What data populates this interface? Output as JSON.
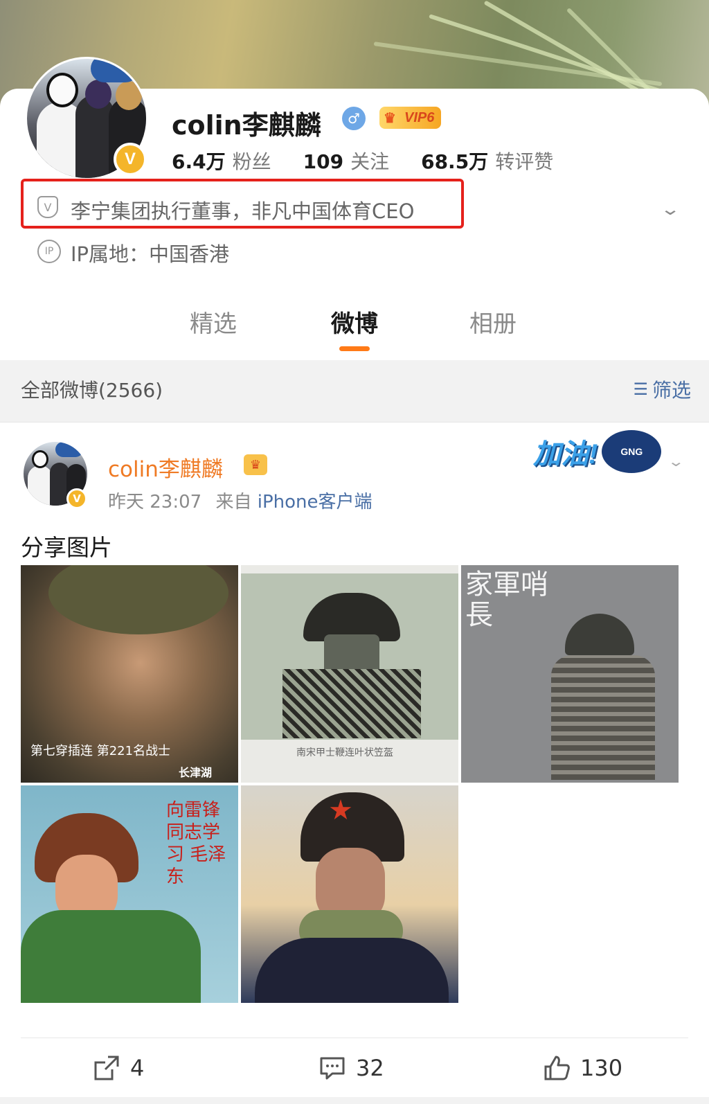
{
  "profile": {
    "name": "colin李麒麟",
    "gender_symbol": "♂",
    "vip_label": "VIP6",
    "verified_badge": "V",
    "stats": [
      {
        "value": "6.4万",
        "label": "粉丝"
      },
      {
        "value": "109",
        "label": "关注"
      },
      {
        "value": "68.5万",
        "label": "转评赞"
      }
    ],
    "bio_icon": "V",
    "bio": "李宁集团执行董事，非凡中国体育CEO",
    "ip_icon": "IP",
    "ip": "IP属地：中国香港"
  },
  "tabs": [
    {
      "label": "精选",
      "active": false
    },
    {
      "label": "微博",
      "active": true
    },
    {
      "label": "相册",
      "active": false
    }
  ],
  "filter_bar": {
    "title": "全部微博(2566)",
    "filter_label": "筛选"
  },
  "post": {
    "author": "colin李麒麟",
    "time": "昨天 23:07",
    "source_prefix": "来自",
    "source": "iPhone客户端",
    "text": "分享图片",
    "sticker_text": "加油!",
    "sticker_logo": "GNG",
    "photo_captions": {
      "photo1": "第七穿插连 第221名战士",
      "photo1_mark": "长津湖",
      "photo2": "南宋甲士鞭连叶状笠盔",
      "photo3": "家軍哨長",
      "photo4": "向雷锋同志学习 毛泽东"
    }
  },
  "actions": [
    {
      "icon": "share-icon",
      "count": "4"
    },
    {
      "icon": "comment-icon",
      "count": "32"
    },
    {
      "icon": "like-icon",
      "count": "130"
    }
  ],
  "colors": {
    "accent_orange": "#ff7a17",
    "highlight_red": "#e5211b",
    "link_blue": "#4a6fa5",
    "vip_gold": "#f6a623"
  }
}
